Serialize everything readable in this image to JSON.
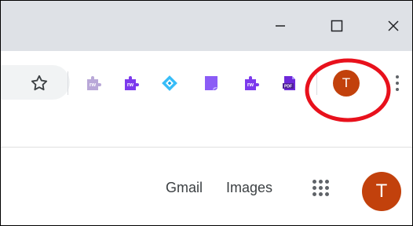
{
  "window_controls": {
    "minimize_icon": "minimize-icon",
    "maximize_icon": "maximize-icon",
    "close_icon": "close-icon"
  },
  "toolbar": {
    "bookmark_icon": "star-icon",
    "extensions": [
      {
        "icon": "puzzle-icon",
        "label": "rw",
        "color": "#b9a8d8"
      },
      {
        "icon": "puzzle-icon",
        "label": "rw",
        "color": "#7c3aed"
      },
      {
        "icon": "diamond-icon",
        "label": "",
        "color": "#38bdf8"
      },
      {
        "icon": "bookmark-shape-icon",
        "label": "",
        "color": "#8b5cf6"
      },
      {
        "icon": "puzzle-icon",
        "label": "rw",
        "color": "#7c3aed"
      },
      {
        "icon": "pdf-icon",
        "label": "PDF",
        "color": "#6d28d9"
      }
    ],
    "profile_initial": "T",
    "menu_icon": "more-vertical-icon"
  },
  "page": {
    "gmail_label": "Gmail",
    "images_label": "Images",
    "apps_icon": "apps-grid-icon",
    "account_initial": "T"
  },
  "colors": {
    "titlebar": "#dee1e6",
    "avatar": "#c2410c",
    "highlight_ring": "#e8111c"
  }
}
